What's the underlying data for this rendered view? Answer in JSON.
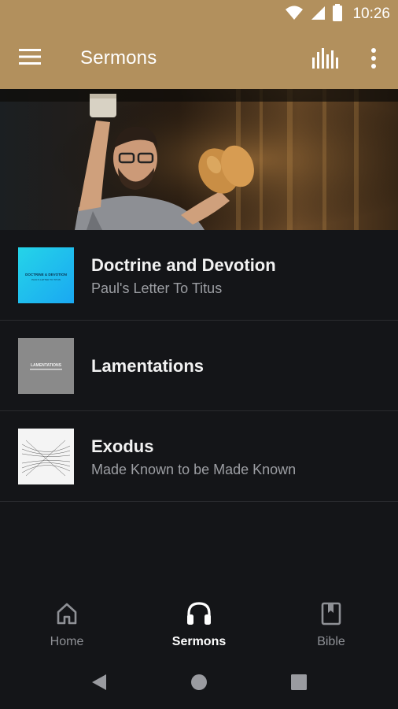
{
  "status_bar": {
    "time": "10:26",
    "icons": [
      "wifi-icon",
      "cell-signal-icon",
      "battery-icon"
    ]
  },
  "app_bar": {
    "title": "Sermons",
    "icons": [
      "hamburger-menu-icon",
      "equalizer-icon",
      "more-vertical-icon"
    ],
    "background_color": "#b2905d"
  },
  "hero": {
    "image_subject": "preacher holding a cup and bread on stage"
  },
  "series": [
    {
      "title": "Doctrine and Devotion",
      "subtitle": "Paul's Letter To Titus",
      "thumb_color": "#1ec6f0",
      "thumb_text": "DOCTRINE & DEVOTION",
      "thumb_subtext": "PAUL'S LETTER TO TITUS"
    },
    {
      "title": "Lamentations",
      "subtitle": "",
      "thumb_color": "#8a8a8a",
      "thumb_text": "LAMENTATIONS"
    },
    {
      "title": "Exodus",
      "subtitle": "Made Known to be Made Known",
      "thumb_color": "#f4f4f4"
    }
  ],
  "bottom_nav": {
    "items": [
      {
        "label": "Home",
        "icon": "home-icon",
        "active": false
      },
      {
        "label": "Sermons",
        "icon": "headphones-icon",
        "active": true
      },
      {
        "label": "Bible",
        "icon": "bookmark-book-icon",
        "active": false
      }
    ]
  },
  "system_nav": {
    "icons": [
      "back-icon",
      "home-circle-icon",
      "recents-square-icon"
    ]
  }
}
